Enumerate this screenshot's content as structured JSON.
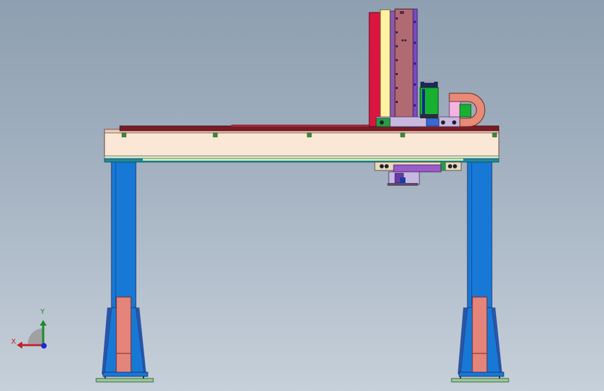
{
  "viewport": {
    "background_top": "#8e9fb1",
    "background_bottom": "#c6d0da"
  },
  "model": {
    "description_icon": "gantry-robot-model",
    "colors": {
      "beam_body": "#fbe7d6",
      "beam_top_rail": "#7b1a28",
      "column_blue": "#1878d6",
      "column_blue_dark": "#2a55a8",
      "column_panel": "#e4847a",
      "foot_plate": "#9ac89a",
      "z_axis_red": "#dc1440",
      "z_axis_yellow": "#fff2a0",
      "z_axis_brown": "#b06a72",
      "z_axis_purple": "#7a4ac4",
      "motor_green": "#18b030",
      "drag_chain": "#e78a78",
      "carriage_purple": "#9a5cc8"
    }
  },
  "triad": {
    "x_label": "X",
    "y_label": "Y",
    "x_color": "#c0202a",
    "y_color": "#1b8a2a",
    "z_color": "#1a2ad8"
  }
}
